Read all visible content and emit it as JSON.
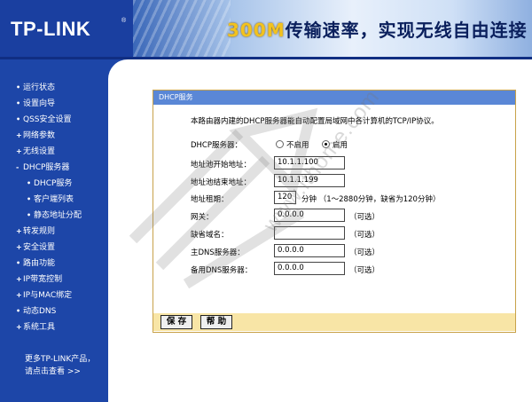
{
  "header": {
    "logo": "TP-LINK",
    "logo_reg": "®",
    "slogan_accent": "300M",
    "slogan_rest": "传输速率，实现无线自由连接"
  },
  "sidebar": {
    "items": [
      {
        "mark": "•",
        "label": "运行状态"
      },
      {
        "mark": "•",
        "label": "设置向导"
      },
      {
        "mark": "•",
        "label": "QSS安全设置"
      },
      {
        "mark": "+",
        "label": "网络参数"
      },
      {
        "mark": "+",
        "label": "无线设置"
      },
      {
        "mark": "-",
        "label": "DHCP服务器"
      },
      {
        "mark": "•",
        "label": "DHCP服务",
        "sub": true,
        "active": true
      },
      {
        "mark": "•",
        "label": "客户端列表",
        "sub": true
      },
      {
        "mark": "•",
        "label": "静态地址分配",
        "sub": true
      },
      {
        "mark": "+",
        "label": "转发规则"
      },
      {
        "mark": "+",
        "label": "安全设置"
      },
      {
        "mark": "•",
        "label": "路由功能"
      },
      {
        "mark": "+",
        "label": "IP带宽控制"
      },
      {
        "mark": "+",
        "label": "IP与MAC绑定"
      },
      {
        "mark": "•",
        "label": "动态DNS"
      },
      {
        "mark": "+",
        "label": "系统工具"
      }
    ],
    "more_line1": "更多TP-LINK产品，",
    "more_line2": "请点击查看 >>"
  },
  "panel": {
    "title": "DHCP服务",
    "description": "本路由器内建的DHCP服务器能自动配置局域网中各计算机的TCP/IP协议。",
    "dhcp_server_label": "DHCP服务器：",
    "option_disable": "不启用",
    "option_enable": "启用",
    "selected": "启用",
    "start_label": "地址池开始地址：",
    "start_value": "10.1.1.100",
    "end_label": "地址池结束地址：",
    "end_value": "10.1.1.199",
    "lease_label": "地址租期：",
    "lease_value": "120",
    "lease_hint": "分钟 （1～2880分钟，缺省为120分钟）",
    "gateway_label": "网关：",
    "gateway_value": "0.0.0.0",
    "domain_label": "缺省域名：",
    "domain_value": "",
    "primary_dns_label": "主DNS服务器：",
    "primary_dns_value": "0.0.0.0",
    "secondary_dns_label": "备用DNS服务器：",
    "secondary_dns_value": "0.0.0.0",
    "optional": "（可选）",
    "save_button": "保 存",
    "help_button": "帮 助"
  },
  "watermark": {
    "text": "www.ithome.com"
  },
  "colors": {
    "sidebar_bg": "#1d46a8",
    "panel_title_bg": "#5a87d6",
    "panel_border": "#c8a24a"
  }
}
